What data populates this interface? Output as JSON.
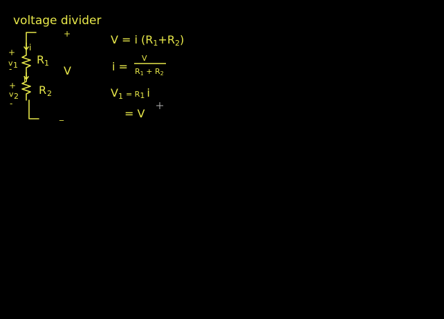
{
  "colors": {
    "background": "#000000",
    "ink": "#e8e84a",
    "cursor": "#b8b8b8"
  },
  "icons": {
    "cursor": "crosshair-cursor-icon"
  },
  "title": "voltage divider",
  "circuit": {
    "r1_label": "R",
    "r1_sub": "1",
    "r2_label": "R",
    "r2_sub": "2",
    "current": "i",
    "v1_label": "v",
    "v1_sub": "1",
    "v2_label": "v",
    "v2_sub": "2",
    "plus": "+",
    "minus": "-",
    "source_plus": "+",
    "source_label": "V",
    "source_minus": "_"
  },
  "equations": {
    "eq1": "V = i (R",
    "eq1_sub1": "1",
    "eq1_plus": "+R",
    "eq1_sub2": "2",
    "eq1_close": ")",
    "eq2_lhs": "i =",
    "eq2_num": "V",
    "eq2_den_a": "R",
    "eq2_den_sub1": "1",
    "eq2_den_plus": " + R",
    "eq2_den_sub2": "2",
    "eq3_lhs": "V",
    "eq3_lhs_sub": "1",
    "eq3_rhs": "= R",
    "eq3_rhs_sub": "1",
    "eq3_rhs_i": "i",
    "eq4": "= V"
  }
}
